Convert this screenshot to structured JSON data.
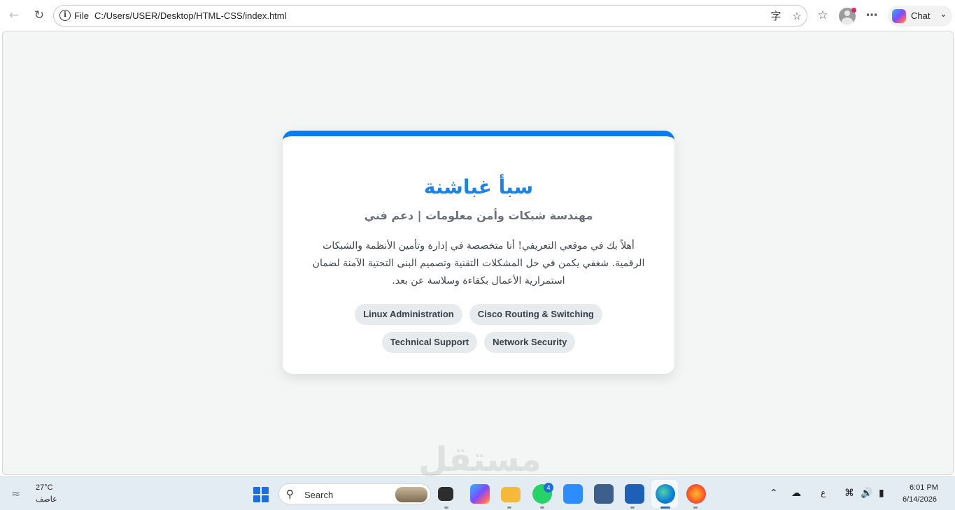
{
  "browser": {
    "address_scheme": "File",
    "address_url": "C:/Users/USER/Desktop/HTML-CSS/index.html",
    "chat_label": "Chat"
  },
  "profile": {
    "name": "سبأ غباشنة",
    "title": "مهندسة شبكات وأمن معلومات | دعم فني",
    "bio": "أهلاً بك في موقعي التعريفي! أنا متخصصة في إدارة وتأمين الأنظمة والشبكات الرقمية. شغفي يكمن في حل المشكلات التقنية وتصميم البنى التحتية الآمنة لضمان استمرارية الأعمال بكفاءة وسلاسة عن بعد.",
    "skills": [
      "Cisco Routing & Switching",
      "Linux Administration",
      "Network Security",
      "Technical Support"
    ]
  },
  "watermark": "مستقل",
  "taskbar": {
    "weather_temp": "27°C",
    "weather_desc": "عاصف",
    "search_placeholder": "Search",
    "whatsapp_badge": "4",
    "input_lang": "ع",
    "time": "6:01 PM",
    "date": "6/14/2026"
  },
  "colors": {
    "accent": "#0a7cf2",
    "name": "#1a82e8",
    "page_bg": "#f4f6f6"
  }
}
